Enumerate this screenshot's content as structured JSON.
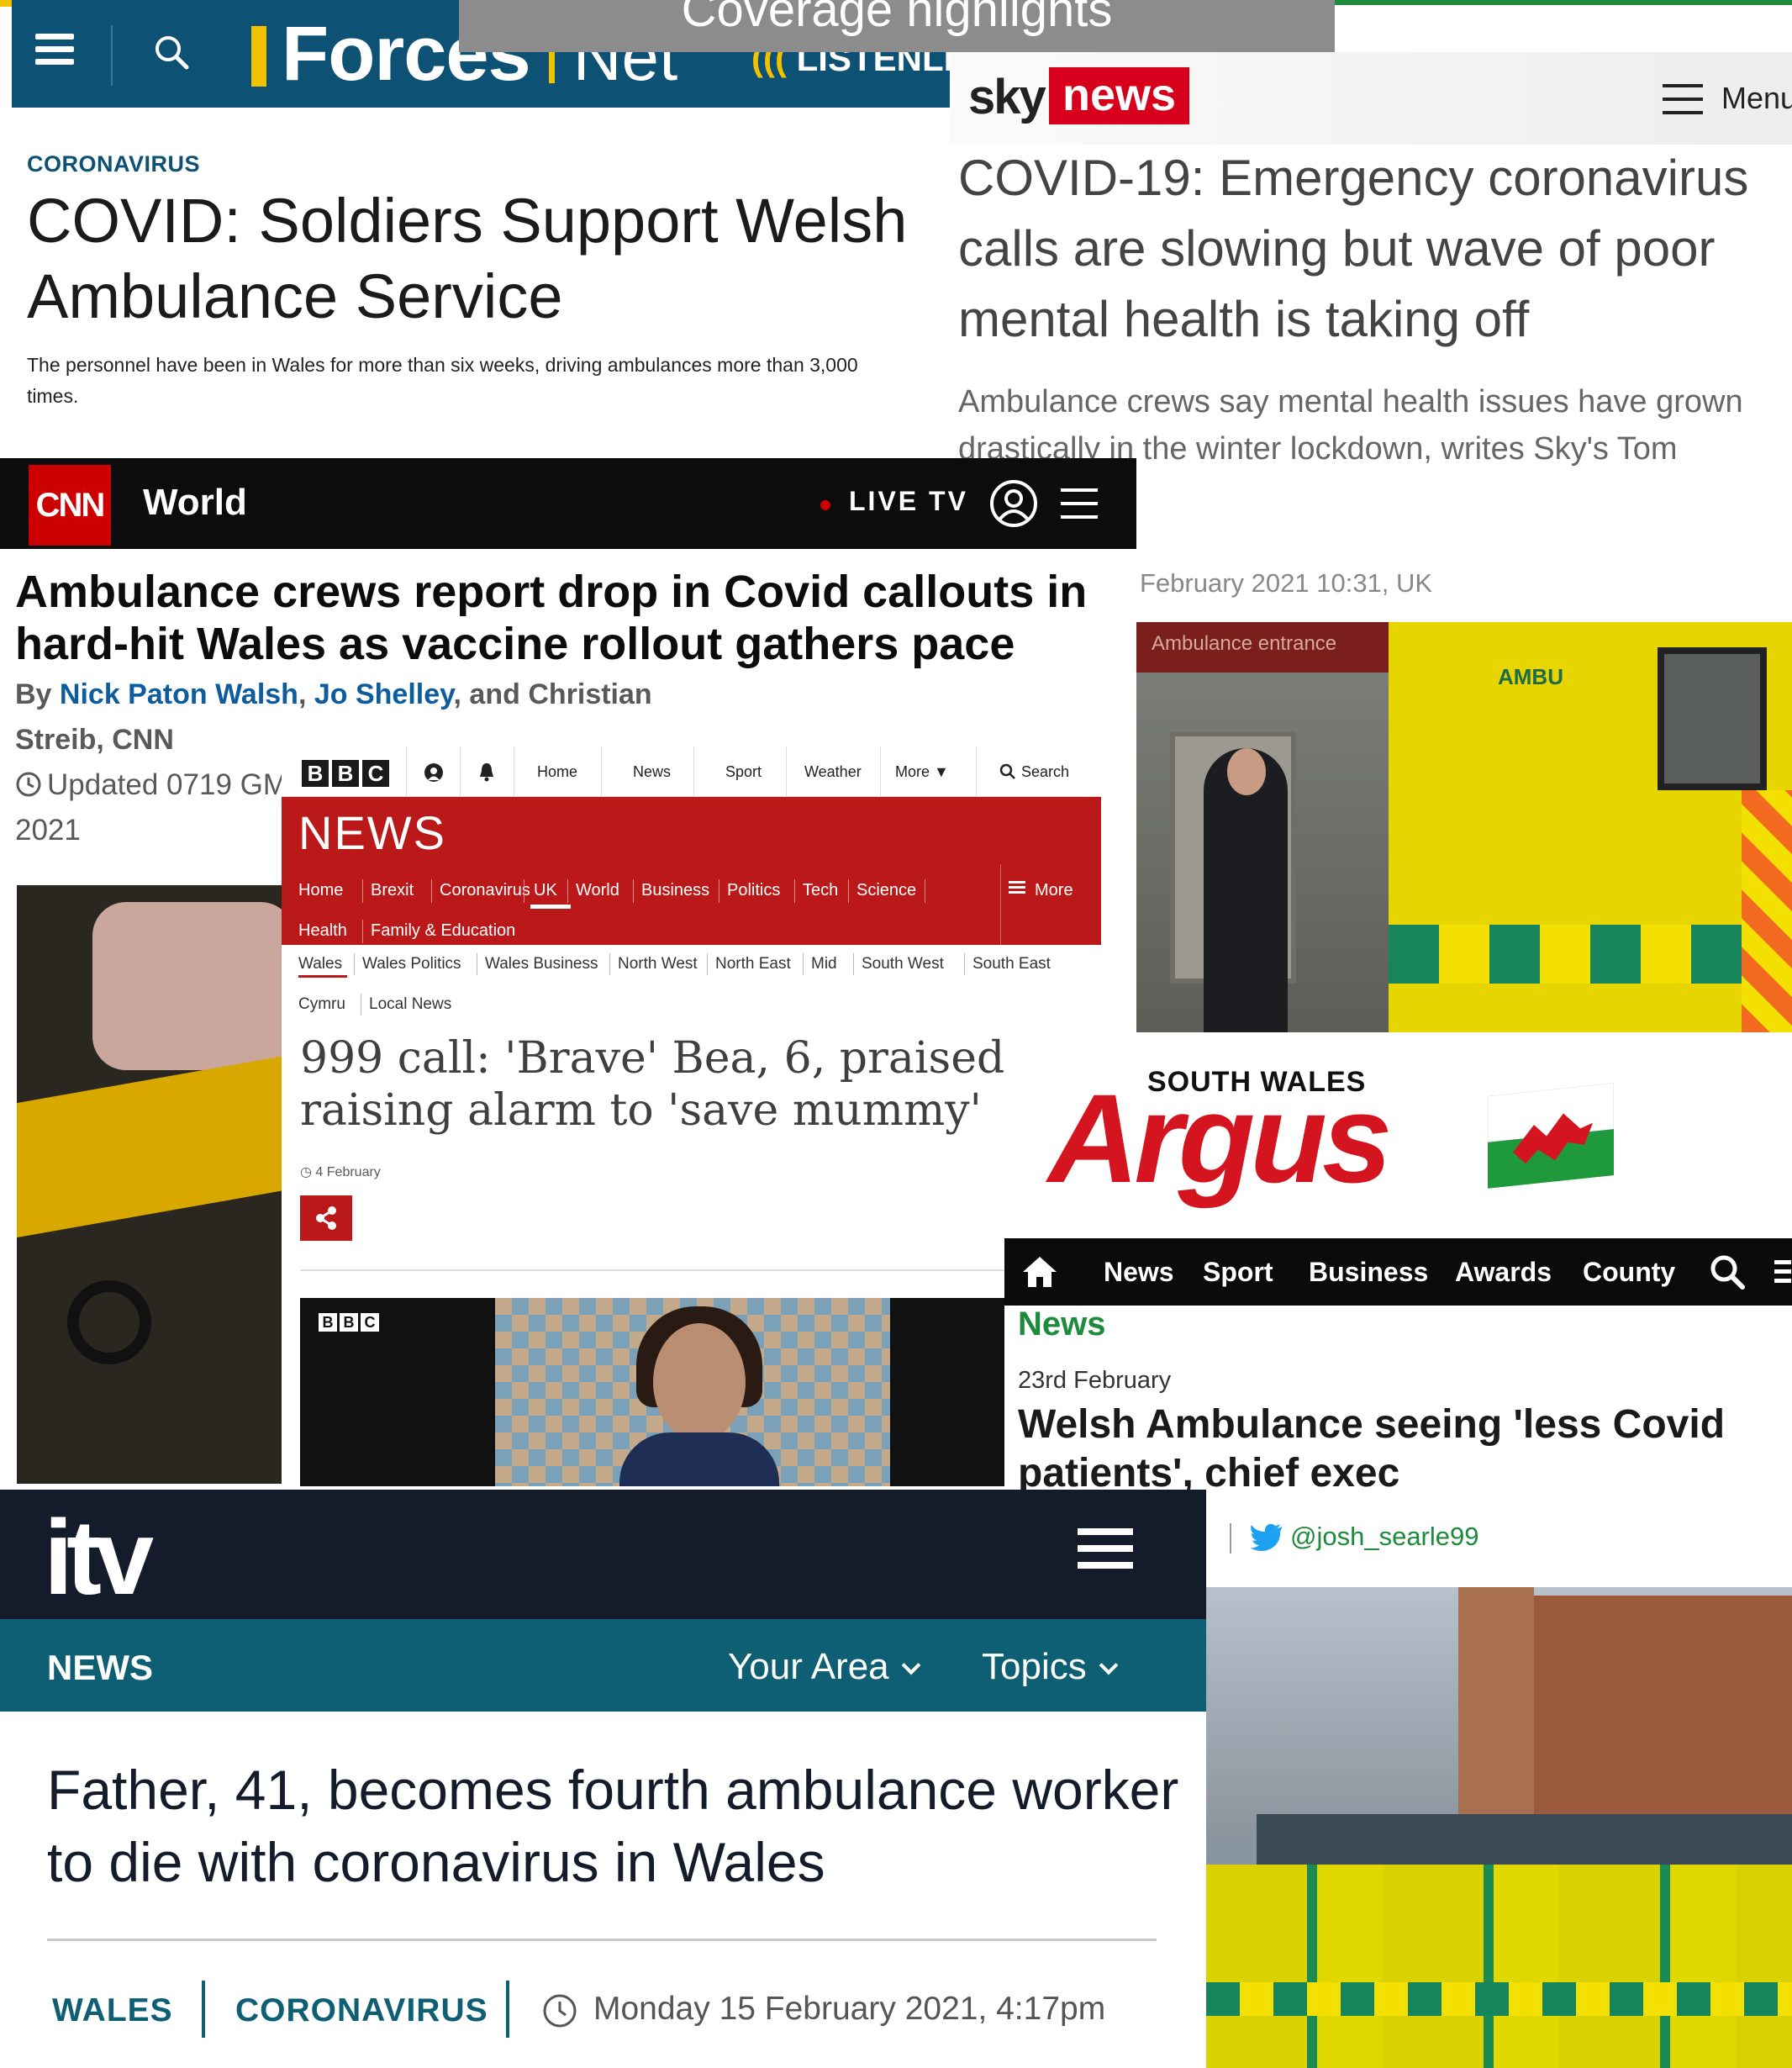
{
  "collage_title": "Coverage highlights",
  "forces": {
    "logo_primary": "Forces",
    "logo_secondary": "Net",
    "listen_prefix": "LISTEN",
    "listen_suffix": "LIVE",
    "kicker": "CORONAVIRUS",
    "headline": "COVID: Soldiers Support Welsh Ambulance Service",
    "standfirst": "The personnel have been in Wales for more than six weeks, driving ambulances more than 3,000 times."
  },
  "sky": {
    "logo_sky": "sky",
    "logo_news": "news",
    "menu_label": "Menu",
    "headline": "COVID-19: Emergency coronavirus calls are slowing but wave of poor mental health is taking off",
    "standfirst": "Ambulance crews say mental health issues have grown drastically in the winter lockdown, writes Sky's Tom",
    "dateline": "February 2021 10:31, UK",
    "photo_sign": "Ambulance entrance",
    "photo_vehicle_text": "AMBU"
  },
  "cnn": {
    "logo": "CNN",
    "section": "World",
    "live_label": "LIVE TV",
    "headline": "Ambulance crews report drop in Covid callouts in hard-hit Wales as vaccine rollout gathers pace",
    "byline_prefix": "By",
    "author_1": "Nick Paton Walsh",
    "author_2": "Jo Shelley",
    "byline_suffix": ", and Christian Streib, CNN",
    "updated_line_1": "Updated 0719 GM",
    "updated_line_2": "2021"
  },
  "bbc": {
    "top_nav": [
      "Home",
      "News",
      "Sport",
      "Weather",
      "More",
      "Search"
    ],
    "section_title": "NEWS",
    "subnav": [
      "Home",
      "Brexit",
      "Coronavirus",
      "UK",
      "World",
      "Business",
      "Politics",
      "Tech",
      "Science",
      "Health",
      "Family & Education"
    ],
    "subnav_more": "More",
    "regional_nav": [
      "Wales",
      "Wales Politics",
      "Wales Business",
      "North West",
      "North East",
      "Mid",
      "South West",
      "South East",
      "Cymru",
      "Local News"
    ],
    "headline": "999 call: 'Brave' Bea, 6, praised raising alarm to 'save mummy'",
    "date": "4 February"
  },
  "argus": {
    "logo_small": "SOUTH WALES",
    "logo_big": "Argus",
    "nav": [
      "News",
      "Sport",
      "Business",
      "Awards",
      "County"
    ],
    "section": "News",
    "date": "23rd February",
    "headline": "Welsh Ambulance seeing 'less Covid patients', chief exec",
    "byline_fragment": "e",
    "twitter_handle": "@josh_searle99"
  },
  "itv": {
    "logo": "itv",
    "news_label": "NEWS",
    "dropdowns": [
      "Your Area",
      "Topics"
    ],
    "headline": "Father, 41, becomes fourth ambulance worker to die with coronavirus in Wales",
    "tag_1": "WALES",
    "tag_2": "CORONAVIRUS",
    "date": "Monday 15 February 2021, 4:17pm"
  },
  "colors": {
    "forces_blue": "#0d5174",
    "forces_yellow": "#f2c200",
    "sky_red": "#d6001c",
    "cnn_red": "#cc0000",
    "bbc_red": "#bb1919",
    "argus_red": "#d4151f",
    "argus_green": "#1e8a3c",
    "itv_navy": "#141b2b",
    "itv_teal": "#0e5f73"
  }
}
